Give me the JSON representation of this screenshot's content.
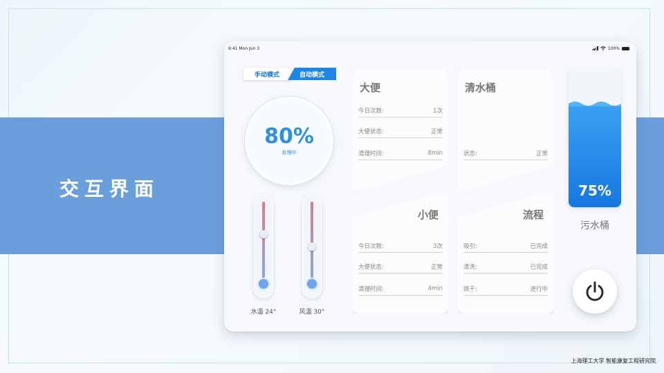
{
  "slide": {
    "title": "交互界面",
    "footer": "上海理工大学 智能康复工程研究院"
  },
  "status_bar": {
    "time_date": "9:41 Mon Jun 3",
    "battery": "100%"
  },
  "mode_switch": {
    "manual_label": "手动模式",
    "auto_label": "自动模式",
    "selected": "自动模式"
  },
  "gauge": {
    "value": "80%",
    "subtitle": "处理中",
    "level": 0.8
  },
  "thermometers": [
    {
      "label": "水温 24°",
      "level": 0.6
    },
    {
      "label": "风温 30°",
      "level": 0.45
    }
  ],
  "cards": {
    "stool": {
      "title": "大便",
      "rows": [
        {
          "label": "今日次数:",
          "value": "1次"
        },
        {
          "label": "大便状态:",
          "value": "正常"
        },
        {
          "label": "清理时间:",
          "value": "8min"
        }
      ]
    },
    "clean_tank": {
      "title": "清水桶",
      "rows": [
        {
          "label": "状态:",
          "value": "正常"
        }
      ]
    },
    "urine": {
      "title": "小便",
      "rows": [
        {
          "label": "今日次数:",
          "value": "3次"
        },
        {
          "label": "大便状态:",
          "value": "正常"
        },
        {
          "label": "清理时间:",
          "value": "4min"
        }
      ]
    },
    "process": {
      "title": "流程",
      "rows": [
        {
          "label": "吸引:",
          "value": "已完成"
        },
        {
          "label": "清洗:",
          "value": "已完成"
        },
        {
          "label": "烘干:",
          "value": "进行中"
        }
      ]
    }
  },
  "waste_tank": {
    "value": "75%",
    "label": "污水桶",
    "level": 0.75
  },
  "colors": {
    "accent": "#1d86e6",
    "band": "#6a9fdc",
    "gauge_text": "#2e8fe3"
  },
  "icons": [
    "signal-icon",
    "wifi-icon",
    "battery-icon",
    "power-icon"
  ]
}
